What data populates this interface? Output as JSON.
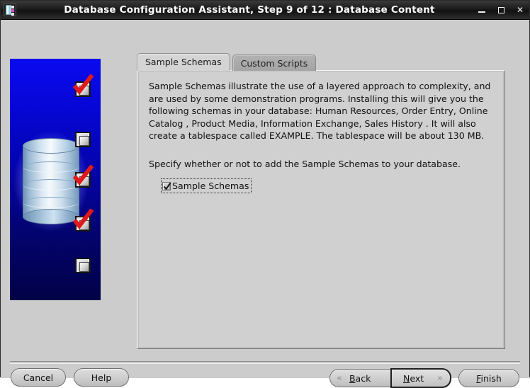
{
  "window": {
    "title": "Database Configuration Assistant, Step 9 of 12 : Database Content",
    "icon": "database-app-icon",
    "controls": {
      "minimize": "minimize-icon",
      "maximize": "maximize-icon",
      "close": "close-icon"
    }
  },
  "banner": {
    "graphic": "database-cylinder-graphic",
    "markers": [
      {
        "state": "checked"
      },
      {
        "state": "unchecked"
      },
      {
        "state": "checked"
      },
      {
        "state": "checked"
      },
      {
        "state": "unchecked"
      }
    ],
    "colors": {
      "gradient_top": "#0a0af0",
      "gradient_bottom": "#020247",
      "check_red": "#e0191b"
    }
  },
  "tabs": [
    {
      "label": "Sample Schemas",
      "active": true
    },
    {
      "label": "Custom Scripts",
      "active": false
    }
  ],
  "content": {
    "body_text": "Sample Schemas illustrate the use of a layered approach to complexity, and are used by some demonstration programs. Installing this will give you the following schemas in your database: Human Resources, Order Entry, Online Catalog , Product Media, Information Exchange, Sales History . It will also create a tablespace called EXAMPLE. The tablespace will be about 130 MB.",
    "specify_text": "Specify whether or not to add the Sample Schemas to your database.",
    "checkbox": {
      "label": "Sample Schemas",
      "checked": true,
      "focused": true
    }
  },
  "footer": {
    "cancel_label": "Cancel",
    "help_label": "Help",
    "back": {
      "label": "Back",
      "mnemonic": "B",
      "chevron": "«"
    },
    "next": {
      "label": "Next",
      "mnemonic": "N",
      "chevron": "»",
      "focused": true
    },
    "finish": {
      "label": "Finish",
      "mnemonic": "F"
    }
  }
}
